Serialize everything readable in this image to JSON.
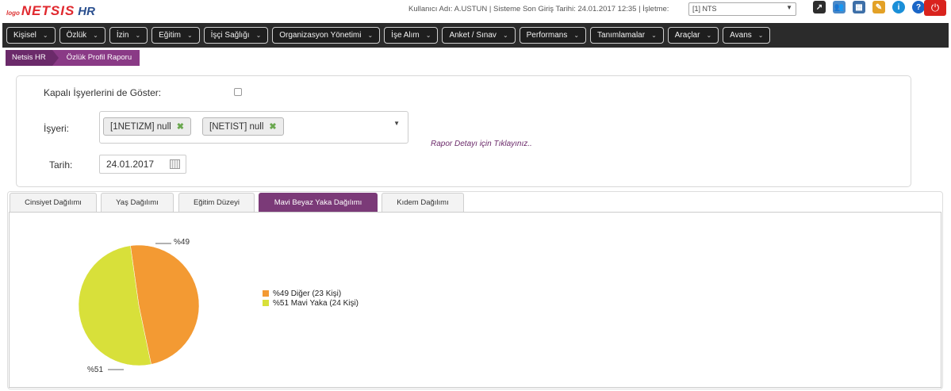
{
  "header": {
    "logo_small": "logo",
    "logo_brand": "NETSIS",
    "logo_hr": "HR",
    "user_info": "Kullanıcı Adı: A.USTUN | Sisteme Son Giriş Tarihi: 24.01.2017 12:35 | İşletme:",
    "company_value": "[1] NTS",
    "icons": [
      "external-link-icon",
      "users-icon",
      "grid-icon",
      "folder-icon",
      "info-icon",
      "help-icon",
      "power-icon"
    ]
  },
  "nav": {
    "items": [
      "Kişisel",
      "Özlük",
      "İzin",
      "Eğitim",
      "İşçi Sağlığı",
      "Organizasyon Yönetimi",
      "İşe Alım",
      "Anket / Sınav",
      "Performans",
      "Tanımlamalar",
      "Araçlar",
      "Avans"
    ]
  },
  "breadcrumb": {
    "home": "Netsis HR",
    "current": "Özlük Profil Raporu"
  },
  "filters": {
    "closed_label": "Kapalı İşyerlerini de Göster:",
    "workplace_label": "İşyeri:",
    "workplace_chips": [
      "[1NETIZM] null",
      "[NETIST] null"
    ],
    "report_link": "Rapor Detayı için Tıklayınız..",
    "date_label": "Tarih:",
    "date_value": "24.01.2017"
  },
  "tabs": [
    "Cinsiyet Dağılımı",
    "Yaş Dağılımı",
    "Eğitim Düzeyi",
    "Mavi Beyaz Yaka Dağılımı",
    "Kıdem Dağılımı"
  ],
  "active_tab": 3,
  "colors": {
    "accent": "#7b3a78",
    "slice_orange": "#f39a33",
    "slice_yellow": "#d8e03a"
  },
  "chart_data": {
    "type": "pie",
    "labels": [
      "%49",
      "%51"
    ],
    "legend": [
      "%49 Diğer (23 Kişi)",
      "%51 Mavi Yaka (24 Kişi)"
    ],
    "values": [
      23,
      24
    ],
    "percent": [
      49,
      51
    ],
    "colors": [
      "#f39a33",
      "#d8e03a"
    ],
    "legend_position": "right"
  }
}
